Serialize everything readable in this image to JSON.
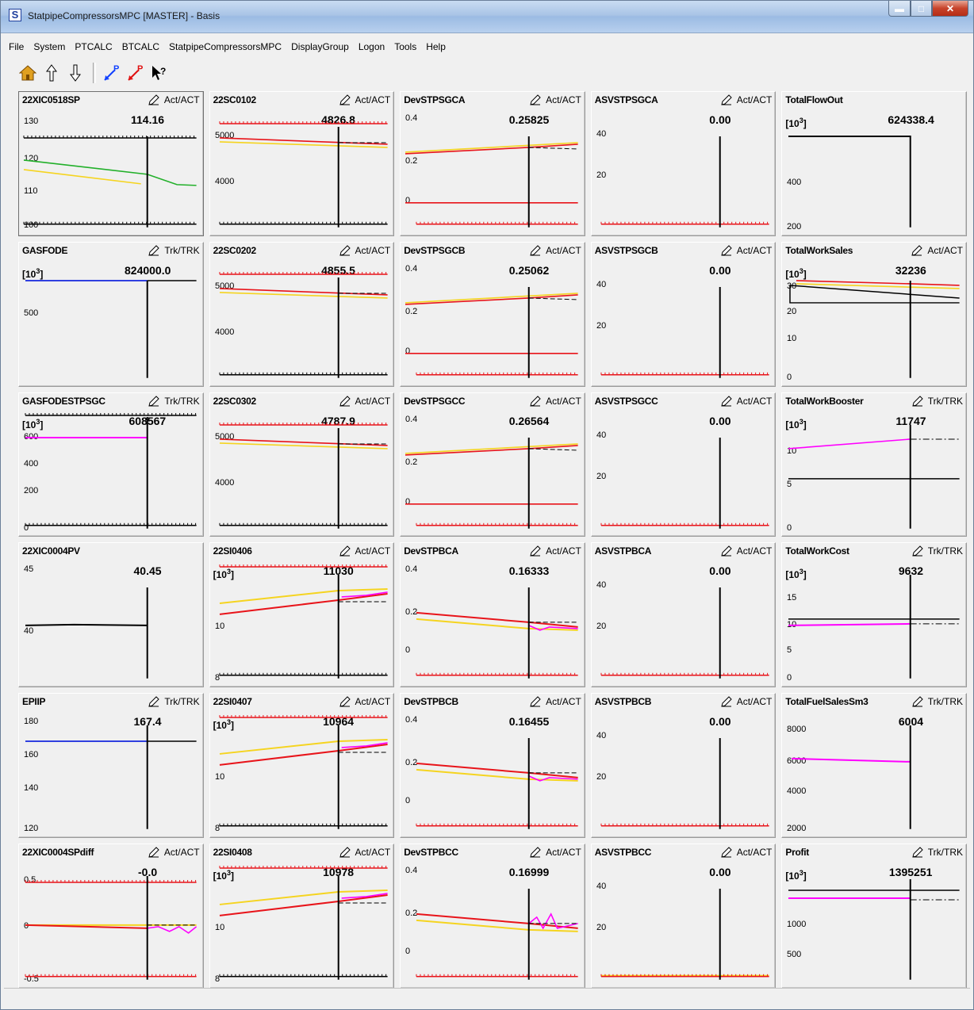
{
  "window": {
    "title": "StatpipeCompressorsMPC [MASTER]  - Basis"
  },
  "menu": [
    "File",
    "System",
    "PTCALC",
    "BTCALC",
    "StatpipeCompressorsMPC",
    "DisplayGroup",
    "Logon",
    "Tools",
    "Help"
  ],
  "toolbar": [
    "home-icon",
    "arrow-up-icon",
    "arrow-down-icon",
    "p-blue-icon",
    "p-red-icon",
    "help-pointer-icon"
  ],
  "colors": {
    "red": "#e8141a",
    "yellow": "#f5d420",
    "magenta": "#ff00ff",
    "green": "#22b02a",
    "blue": "#3040e0",
    "black": "#000000"
  },
  "panels": [
    {
      "tag": "22XIC0518SP",
      "mode": "Act/ACT",
      "value": "114.16",
      "unit": "",
      "ticks": [
        "130",
        "120",
        "110",
        "100"
      ],
      "kind": "xic0518",
      "sel": true
    },
    {
      "tag": "22SC0102",
      "mode": "Act/ACT",
      "value": "4826.8",
      "unit": "",
      "ticks": [
        "5000",
        "4000"
      ],
      "kind": "sc"
    },
    {
      "tag": "DevSTPSGCA",
      "mode": "Act/ACT",
      "value": "0.25825",
      "unit": "",
      "ticks": [
        "0.4",
        "0.2",
        "0"
      ],
      "kind": "devsg"
    },
    {
      "tag": "ASVSTPSGCA",
      "mode": "Act/ACT",
      "value": "0.00",
      "unit": "",
      "ticks": [
        "40",
        "20",
        "0"
      ],
      "kind": "asv"
    },
    {
      "tag": "TotalFlowOut",
      "mode": "",
      "value": "624338.4",
      "unit": "[10^3]",
      "ticks": [
        "400",
        "200"
      ],
      "kind": "flowout"
    },
    {
      "tag": "GASFODE",
      "mode": "Trk/TRK",
      "value": "824000.0",
      "unit": "[10^3]",
      "ticks": [
        "500"
      ],
      "kind": "gasfode"
    },
    {
      "tag": "22SC0202",
      "mode": "Act/ACT",
      "value": "4855.5",
      "unit": "",
      "ticks": [
        "5000",
        "4000"
      ],
      "kind": "sc"
    },
    {
      "tag": "DevSTPSGCB",
      "mode": "Act/ACT",
      "value": "0.25062",
      "unit": "",
      "ticks": [
        "0.4",
        "0.2",
        "0"
      ],
      "kind": "devsg"
    },
    {
      "tag": "ASVSTPSGCB",
      "mode": "Act/ACT",
      "value": "0.00",
      "unit": "",
      "ticks": [
        "40",
        "20",
        "0"
      ],
      "kind": "asv"
    },
    {
      "tag": "TotalWorkSales",
      "mode": "Act/ACT",
      "value": "32236",
      "unit": "[10^3]",
      "ticks": [
        "30",
        "20",
        "10",
        "0"
      ],
      "kind": "worksales"
    },
    {
      "tag": "GASFODESTPSGC",
      "mode": "Trk/TRK",
      "value": "608567",
      "unit": "[10^3]",
      "ticks": [
        "600",
        "400",
        "200",
        "0"
      ],
      "kind": "gasfodestp"
    },
    {
      "tag": "22SC0302",
      "mode": "Act/ACT",
      "value": "4787.9",
      "unit": "",
      "ticks": [
        "5000",
        "4000"
      ],
      "kind": "sc"
    },
    {
      "tag": "DevSTPSGCC",
      "mode": "Act/ACT",
      "value": "0.26564",
      "unit": "",
      "ticks": [
        "0.4",
        "0.2",
        "0"
      ],
      "kind": "devsg"
    },
    {
      "tag": "ASVSTPSGCC",
      "mode": "Act/ACT",
      "value": "0.00",
      "unit": "",
      "ticks": [
        "40",
        "20",
        "0"
      ],
      "kind": "asv"
    },
    {
      "tag": "TotalWorkBooster",
      "mode": "Trk/TRK",
      "value": "11747",
      "unit": "[10^3]",
      "ticks": [
        "10",
        "5",
        "0"
      ],
      "kind": "booster"
    },
    {
      "tag": "22XIC0004PV",
      "mode": "",
      "value": "40.45",
      "unit": "",
      "ticks": [
        "45",
        "40"
      ],
      "kind": "xic0004pv"
    },
    {
      "tag": "22SI0406",
      "mode": "Act/ACT",
      "value": "11030",
      "unit": "[10^3]",
      "ticks": [
        "10",
        "8"
      ],
      "kind": "si"
    },
    {
      "tag": "DevSTPBCA",
      "mode": "Act/ACT",
      "value": "0.16333",
      "unit": "",
      "ticks": [
        "0.4",
        "0.2",
        "0"
      ],
      "kind": "devbc"
    },
    {
      "tag": "ASVSTPBCA",
      "mode": "Act/ACT",
      "value": "0.00",
      "unit": "",
      "ticks": [
        "40",
        "20",
        "0"
      ],
      "kind": "asv"
    },
    {
      "tag": "TotalWorkCost",
      "mode": "Trk/TRK",
      "value": "9632",
      "unit": "[10^3]",
      "ticks": [
        "15",
        "10",
        "5",
        "0"
      ],
      "kind": "workcost"
    },
    {
      "tag": "EPIIP",
      "mode": "Trk/TRK",
      "value": "167.4",
      "unit": "",
      "ticks": [
        "180",
        "160",
        "140",
        "120"
      ],
      "kind": "epiip"
    },
    {
      "tag": "22SI0407",
      "mode": "Act/ACT",
      "value": "10964",
      "unit": "[10^3]",
      "ticks": [
        "10",
        "8"
      ],
      "kind": "si"
    },
    {
      "tag": "DevSTPBCB",
      "mode": "Act/ACT",
      "value": "0.16455",
      "unit": "",
      "ticks": [
        "0.4",
        "0.2",
        "0"
      ],
      "kind": "devbc"
    },
    {
      "tag": "ASVSTPBCB",
      "mode": "Act/ACT",
      "value": "0.00",
      "unit": "",
      "ticks": [
        "40",
        "20",
        "0"
      ],
      "kind": "asv"
    },
    {
      "tag": "TotalFuelSalesSm3",
      "mode": "Trk/TRK",
      "value": "6004",
      "unit": "",
      "ticks": [
        "8000",
        "6000",
        "4000",
        "2000"
      ],
      "kind": "fuelsales"
    },
    {
      "tag": "22XIC0004SPdiff",
      "mode": "Act/ACT",
      "value": "-0.0",
      "unit": "",
      "ticks": [
        "0.5",
        "0",
        "-0.5"
      ],
      "kind": "spdiff"
    },
    {
      "tag": "22SI0408",
      "mode": "Act/ACT",
      "value": "10978",
      "unit": "[10^3]",
      "ticks": [
        "10",
        "8"
      ],
      "kind": "si"
    },
    {
      "tag": "DevSTPBCC",
      "mode": "Act/ACT",
      "value": "0.16999",
      "unit": "",
      "ticks": [
        "0.4",
        "0.2",
        "0"
      ],
      "kind": "devbc2"
    },
    {
      "tag": "ASVSTPBCC",
      "mode": "Act/ACT",
      "value": "0.00",
      "unit": "",
      "ticks": [
        "40",
        "20",
        "0"
      ],
      "kind": "asvy"
    },
    {
      "tag": "Profit",
      "mode": "Trk/TRK",
      "value": "1395251",
      "unit": "[10^3]",
      "ticks": [
        "1000",
        "500"
      ],
      "kind": "profit"
    }
  ]
}
